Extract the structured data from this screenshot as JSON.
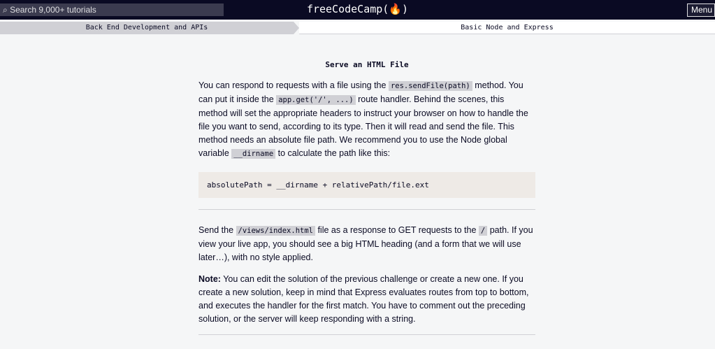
{
  "nav": {
    "search_placeholder": "Search 9,000+ tutorials",
    "logo": "freeCodeCamp(🔥)",
    "menu": "Menu"
  },
  "breadcrumb": {
    "superblock": "Back End Development and APIs",
    "block": "Basic Node and Express"
  },
  "challenge": {
    "title": "Serve an HTML File",
    "p1": [
      "You can respond to requests with a file using the ",
      "res.sendFile(path)",
      " method. You can put it inside the ",
      "app.get('/', ...)",
      " route handler. Behind the scenes, this method will set the appropriate headers to instruct your browser on how to handle the file you want to send, according to its type. Then it will read and send the file. This method needs an absolute file path. We recommend you to use the Node global variable ",
      "__dirname",
      " to calculate the path like this:"
    ],
    "code": "absolutePath = __dirname + relativePath/file.ext",
    "p2": [
      "Send the ",
      "/views/index.html",
      " file as a response to GET requests to the ",
      "/",
      " path. If you view your live app, you should see a big HTML heading (and a form that we will use later…), with no style applied."
    ],
    "note_label": "Note:",
    "note": " You can edit the solution of the previous challenge or create a new one. If you create a new solution, keep in mind that Express evaluates routes from top to bottom, and executes the handler for the first match. You have to comment out the preceding solution, or the server will keep responding with a string."
  }
}
